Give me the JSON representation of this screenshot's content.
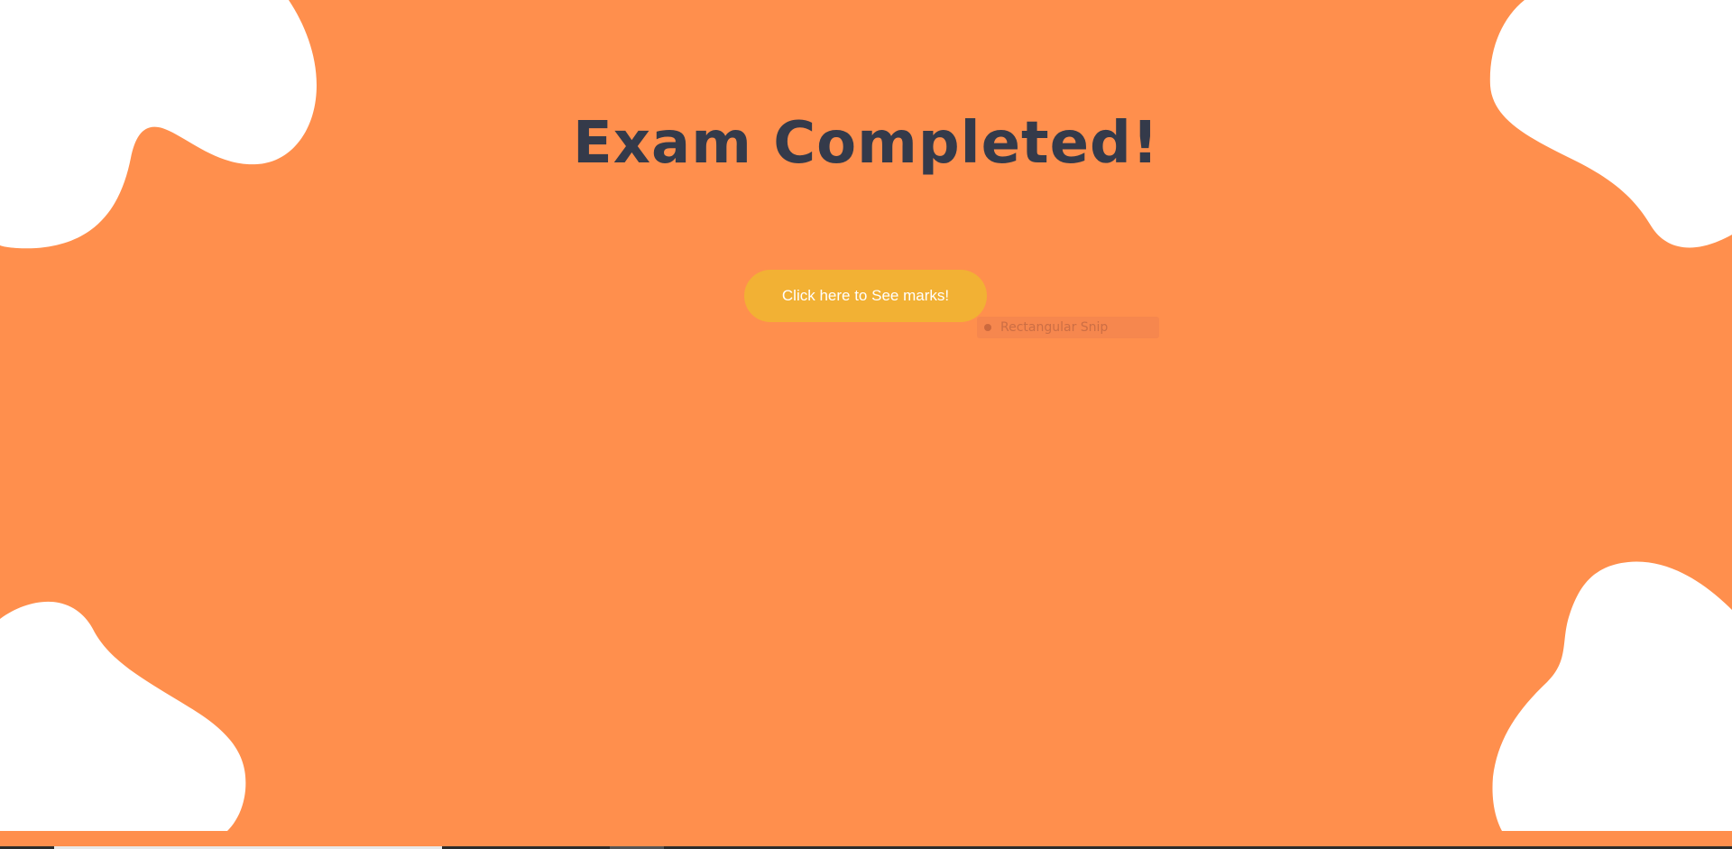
{
  "page": {
    "title": "Exam Completed!",
    "marks_button_label": "Click here to See marks!"
  },
  "overlay": {
    "snip_label": "Rectangular Snip"
  },
  "colors": {
    "background": "#ff8f4d",
    "blob": "#ffffff",
    "title": "#343a4a",
    "button": "#f2b134",
    "button_text": "#ffffff"
  }
}
